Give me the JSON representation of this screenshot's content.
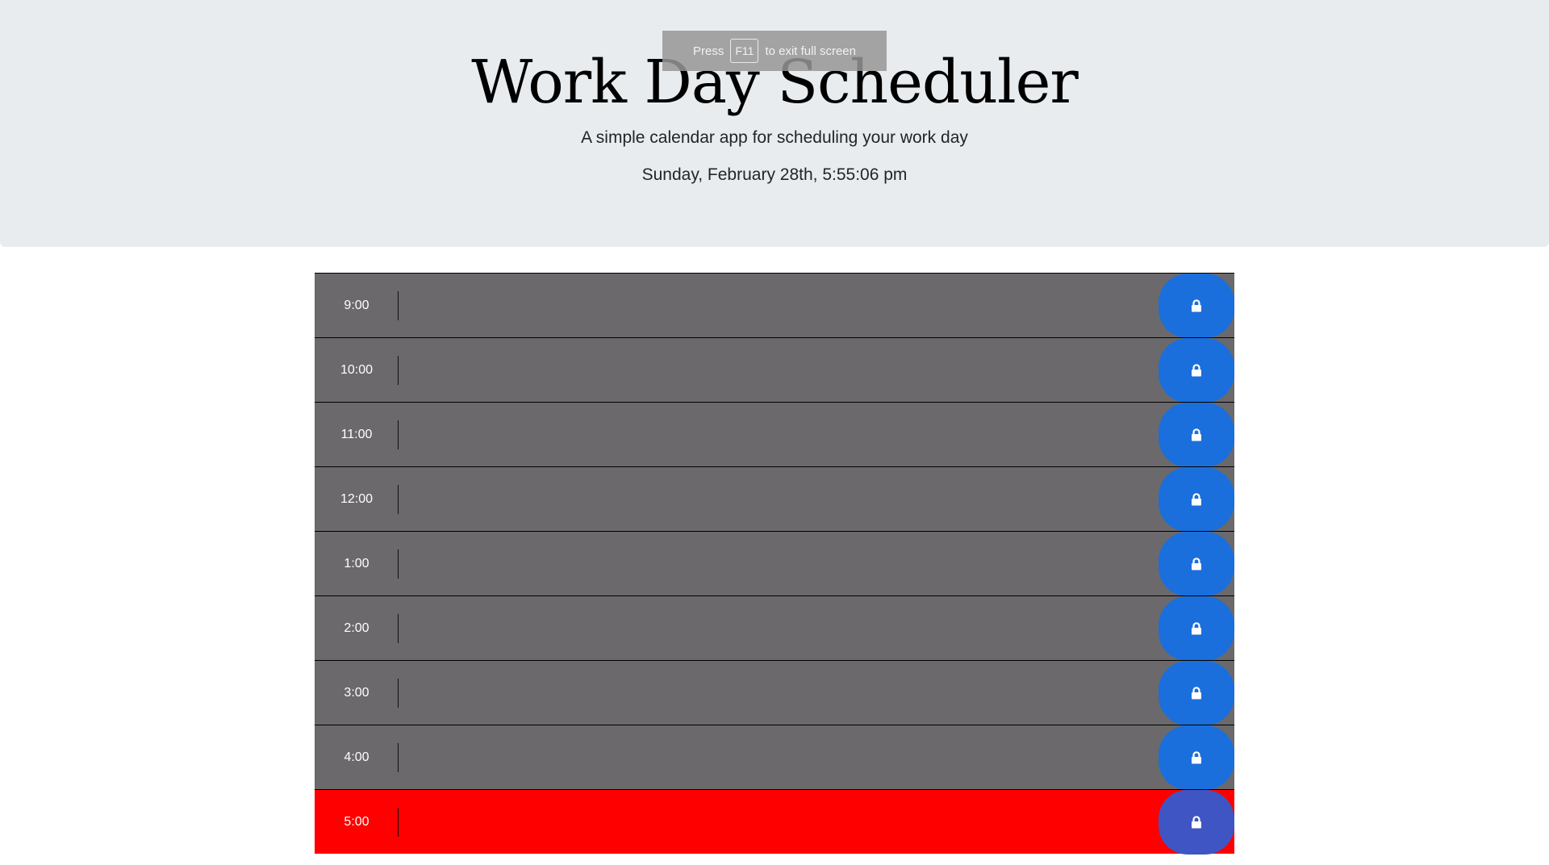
{
  "header": {
    "title": "Work Day Scheduler",
    "subtitle": "A simple calendar app for scheduling your work day",
    "current_day": "Sunday, February 28th, 5:55:06 pm"
  },
  "fullscreen_toast": {
    "press": "Press",
    "key": "F11",
    "rest": "to exit full screen"
  },
  "colors": {
    "past": "#6b696b",
    "present": "#ff0000",
    "save_button": "#1a6fdc",
    "save_button_present": "#3f55c4",
    "header_bg": "#e9ecef"
  },
  "time_blocks": [
    {
      "hour": "9:00",
      "text": "",
      "state": "past",
      "save_icon": "lock-icon"
    },
    {
      "hour": "10:00",
      "text": "",
      "state": "past",
      "save_icon": "lock-icon"
    },
    {
      "hour": "11:00",
      "text": "",
      "state": "past",
      "save_icon": "lock-icon"
    },
    {
      "hour": "12:00",
      "text": "",
      "state": "past",
      "save_icon": "lock-icon"
    },
    {
      "hour": "1:00",
      "text": "",
      "state": "past",
      "save_icon": "lock-icon"
    },
    {
      "hour": "2:00",
      "text": "",
      "state": "past",
      "save_icon": "lock-icon"
    },
    {
      "hour": "3:00",
      "text": "",
      "state": "past",
      "save_icon": "lock-icon"
    },
    {
      "hour": "4:00",
      "text": "",
      "state": "past",
      "save_icon": "lock-icon"
    },
    {
      "hour": "5:00",
      "text": "",
      "state": "present",
      "save_icon": "lock-icon"
    }
  ]
}
